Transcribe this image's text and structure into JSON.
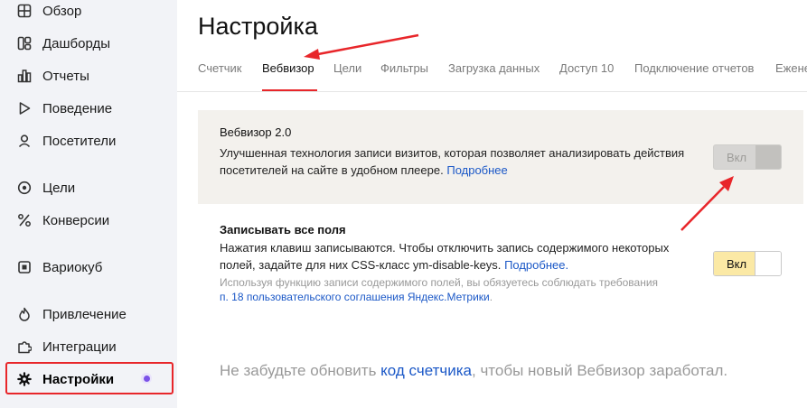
{
  "sidebar": {
    "items": [
      {
        "label": "Обзор",
        "icon": "grid-icon"
      },
      {
        "label": "Дашборды",
        "icon": "dashboards-icon"
      },
      {
        "label": "Отчеты",
        "icon": "reports-icon"
      },
      {
        "label": "Поведение",
        "icon": "play-icon"
      },
      {
        "label": "Посетители",
        "icon": "visitor-icon"
      },
      {
        "label": "Цели",
        "icon": "target-icon"
      },
      {
        "label": "Конверсии",
        "icon": "percent-icon"
      },
      {
        "label": "Вариокуб",
        "icon": "variocube-icon"
      },
      {
        "label": "Привлечение",
        "icon": "flame-icon"
      },
      {
        "label": "Интеграции",
        "icon": "puzzle-icon"
      },
      {
        "label": "Настройки",
        "icon": "gear-icon",
        "active": true
      }
    ]
  },
  "header": {
    "title": "Настройка"
  },
  "tabs": [
    {
      "label": "Счетчик"
    },
    {
      "label": "Вебвизор",
      "active": true
    },
    {
      "label": "Цели"
    },
    {
      "label": "Фильтры"
    },
    {
      "label": "Загрузка данных"
    },
    {
      "label": "Доступ 10"
    },
    {
      "label": "Подключение отчетов"
    },
    {
      "label": "Ежене"
    }
  ],
  "webvisor": {
    "title": "Вебвизор 2.0",
    "text": "Улучшенная технология записи визитов, которая позволяет анализировать действия посетителей на сайте в удобном плеере.",
    "link": "Подробнее",
    "toggle_label": "Вкл"
  },
  "record_fields": {
    "title": "Записывать все поля",
    "text": "Нажатия клавиш записываются. Чтобы отключить запись содержимого некоторых полей, задайте для них CSS-класс ym-disable-keys.",
    "link": "Подробнее.",
    "note_text": "Используя функцию записи содержимого полей, вы обязуетесь соблюдать требования",
    "note_link": "п. 18 пользовательского соглашения Яндекс.Метрики",
    "note_end": ".",
    "toggle_label": "Вкл"
  },
  "footer": {
    "before": "Не забудьте обновить",
    "link": "код счетчика",
    "after": ", чтобы новый Вебвизор заработал."
  },
  "colors": {
    "accent_red": "#e8262a",
    "link_blue": "#1b58c7",
    "toggle_on": "#fbe9a5",
    "badge_purple": "#7b52e8"
  }
}
